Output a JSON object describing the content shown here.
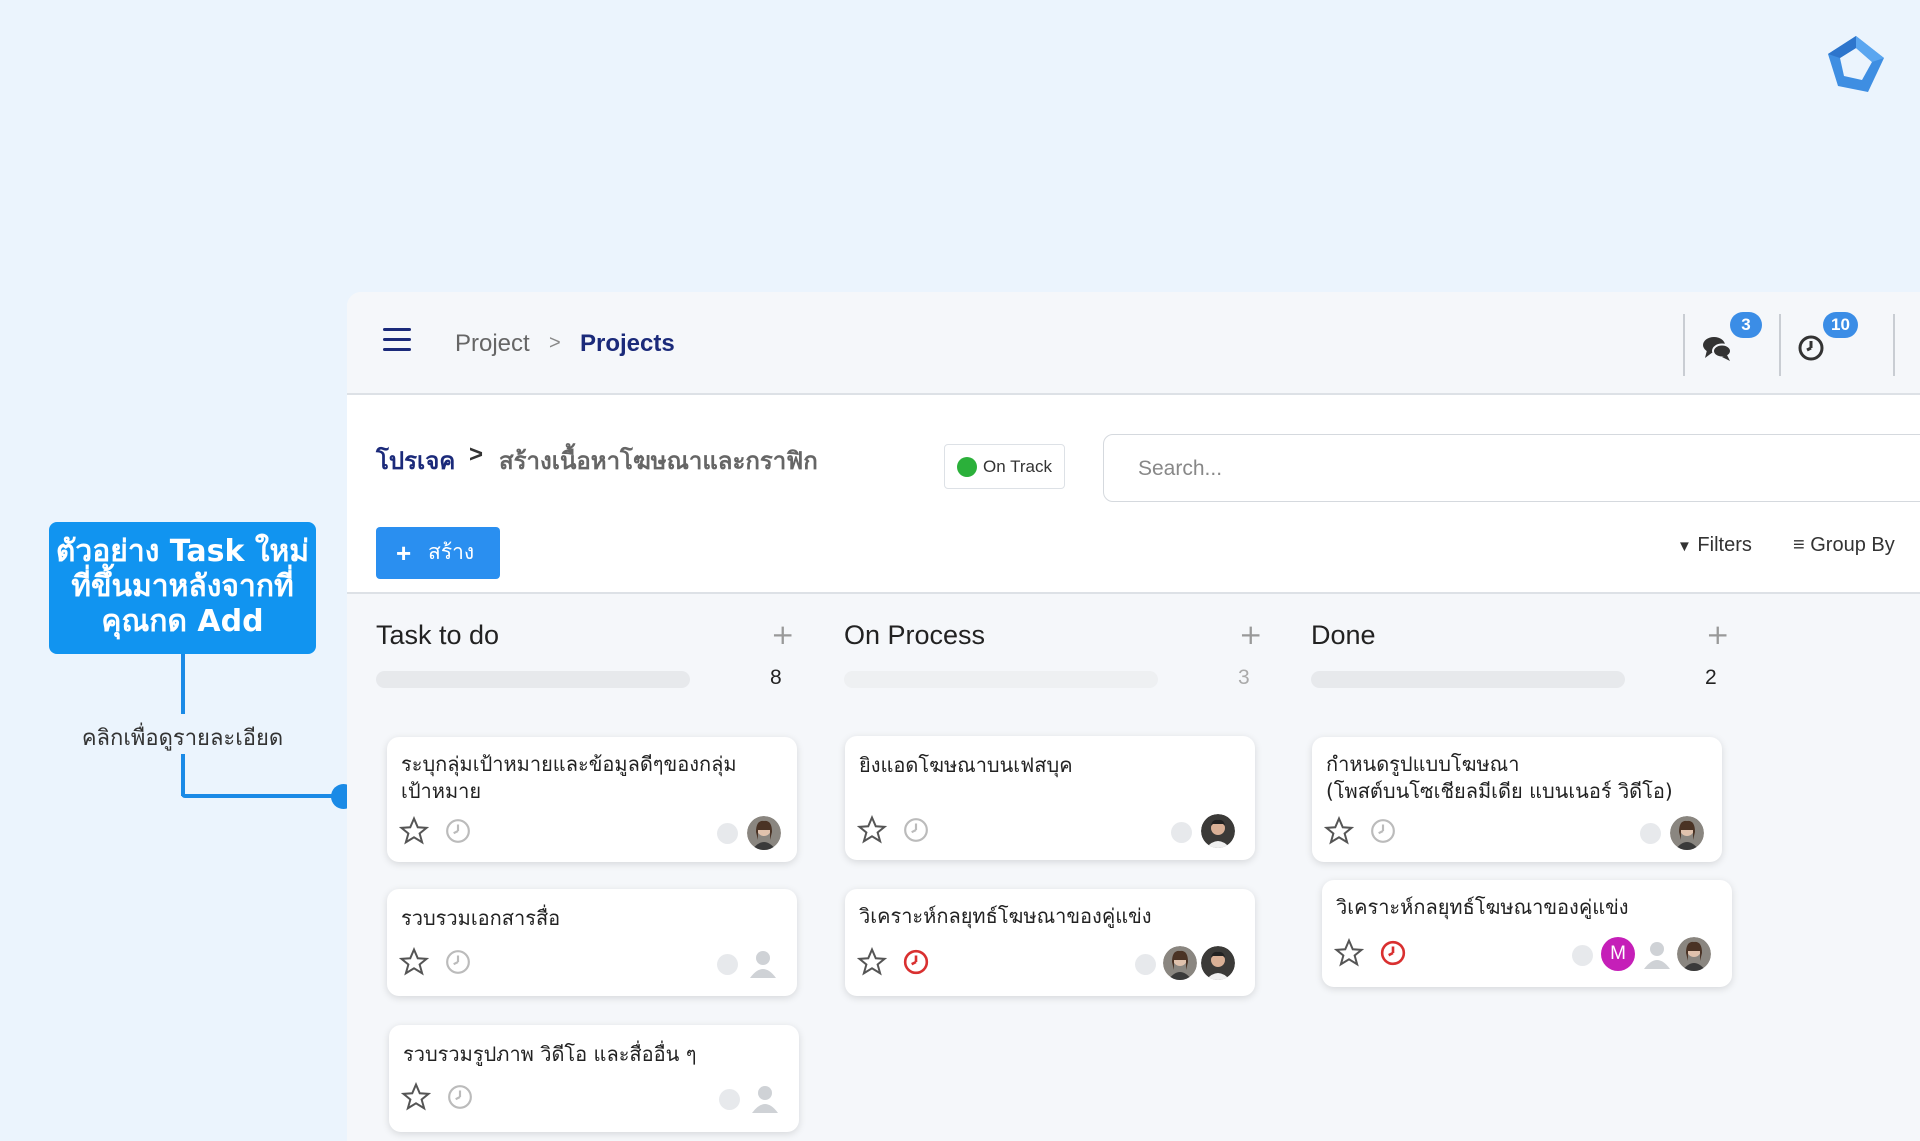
{
  "annotation": {
    "title_line1": "ตัวอย่าง Task ใหม่",
    "title_line2": "ที่ขึ้นมาหลังจากที่",
    "title_line3": "คุณกด Add",
    "label": "คลิกเพื่อดูรายละเอียด"
  },
  "header": {
    "breadcrumb_project": "Project",
    "breadcrumb_sep": ">",
    "breadcrumb_projects": "Projects",
    "chat_count": "3",
    "clock_count": "10"
  },
  "project": {
    "crumb_root": "โปรเจค",
    "crumb_sep": ">",
    "crumb_name": "สร้างเนื้อหาโฆษณาและกราฟิก",
    "status": "On Track",
    "search_placeholder": "Search...",
    "create_label": "สร้าง",
    "filters_label": "Filters",
    "groupby_label": "Group By"
  },
  "columns": [
    {
      "title": "Task to do",
      "count": "8"
    },
    {
      "title": "On Process",
      "count": "3"
    },
    {
      "title": "Done",
      "count": "2"
    }
  ],
  "cards": {
    "todo_1": {
      "line1": "ระบุกลุ่มเป้าหมายและข้อมูลดีๆของกลุ่ม",
      "line2": "เป้าหมาย"
    },
    "todo_2": {
      "line1": "รวบรวมเอกสารสื่อ"
    },
    "todo_3": {
      "line1": "รวบรวมรูปภาพ วิดีโอ และสื่ออื่น ๆ"
    },
    "proc_1": {
      "line1": "ยิงแอดโฆษณาบนเฟสบุค"
    },
    "proc_2": {
      "line1": "วิเคราะห์กลยุทธ์โฆษณาของคู่แข่ง"
    },
    "done_1": {
      "line1": "กำหนดรูปแบบโฆษณา",
      "line2": "(โพสต์บนโซเชียลมีเดีย แบนเนอร์ วิดีโอ)"
    },
    "done_2": {
      "line1": "วิเคราะห์กลยุทธ์โฆษณาของคู่แข่ง",
      "avatar_initial": "M"
    }
  },
  "colors": {
    "accent": "#2a8ff0",
    "nav": "#1b2a7a",
    "status_green": "#2bb03a",
    "overdue_red": "#d93030"
  }
}
